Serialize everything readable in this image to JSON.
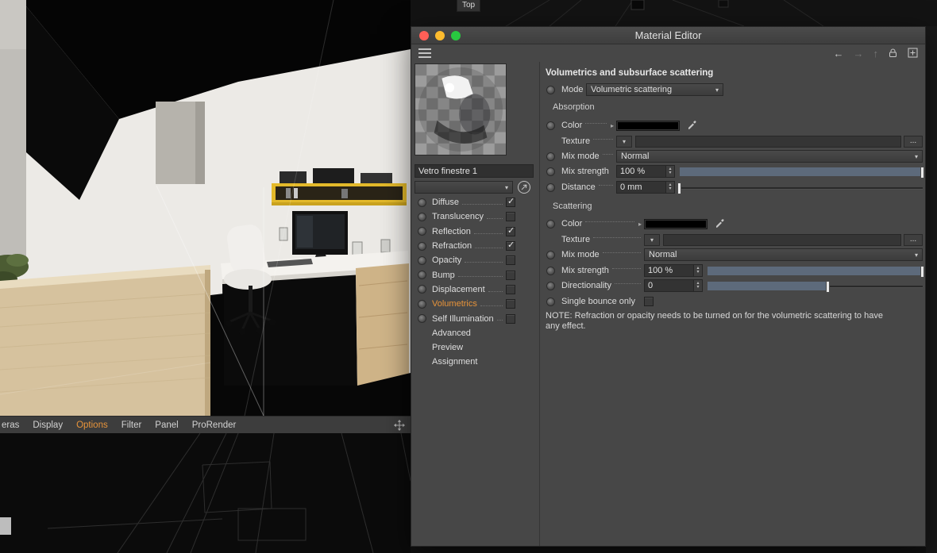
{
  "viewport": {
    "top_view_label": "Top",
    "menu_items": [
      {
        "label": "eras",
        "active": false
      },
      {
        "label": "Display",
        "active": false
      },
      {
        "label": "Options",
        "active": true
      },
      {
        "label": "Filter",
        "active": false
      },
      {
        "label": "Panel",
        "active": false
      },
      {
        "label": "ProRender",
        "active": false
      }
    ]
  },
  "material_editor": {
    "title": "Material Editor",
    "name_value": "Vetro finestre 1",
    "channels": [
      {
        "label": "Diffuse",
        "checked": true
      },
      {
        "label": "Translucency",
        "checked": false
      },
      {
        "label": "Reflection",
        "checked": true
      },
      {
        "label": "Refraction",
        "checked": true
      },
      {
        "label": "Opacity",
        "checked": false
      },
      {
        "label": "Bump",
        "checked": false
      },
      {
        "label": "Displacement",
        "checked": false
      },
      {
        "label": "Volumetrics",
        "checked": false,
        "highlight": true
      },
      {
        "label": "Self Illumination",
        "checked": false
      },
      {
        "label": "Advanced"
      },
      {
        "label": "Preview"
      },
      {
        "label": "Assignment"
      }
    ],
    "panel": {
      "heading": "Volumetrics and subsurface scattering",
      "mode": {
        "label": "Mode",
        "value": "Volumetric scattering"
      },
      "absorption": {
        "title": "Absorption",
        "color_label": "Color",
        "texture_label": "Texture",
        "texture_value": "",
        "browse_label": "...",
        "mix_mode_label": "Mix mode",
        "mix_mode_value": "Normal",
        "mix_strength_label": "Mix strength",
        "mix_strength_value": "100 %",
        "mix_strength_percent": 100,
        "distance_label": "Distance",
        "distance_value": "0 mm",
        "distance_percent": 0
      },
      "scattering": {
        "title": "Scattering",
        "color_label": "Color",
        "texture_label": "Texture",
        "texture_value": "",
        "browse_label": "...",
        "mix_mode_label": "Mix mode",
        "mix_mode_value": "Normal",
        "mix_strength_label": "Mix strength",
        "mix_strength_value": "100 %",
        "mix_strength_percent": 100,
        "directionality_label": "Directionality",
        "directionality_value": "0",
        "directionality_percent": 56,
        "single_bounce_label": "Single bounce only",
        "single_bounce_checked": false
      },
      "note": "NOTE: Refraction or opacity needs to be turned on for the volumetric scattering to have any effect."
    }
  }
}
